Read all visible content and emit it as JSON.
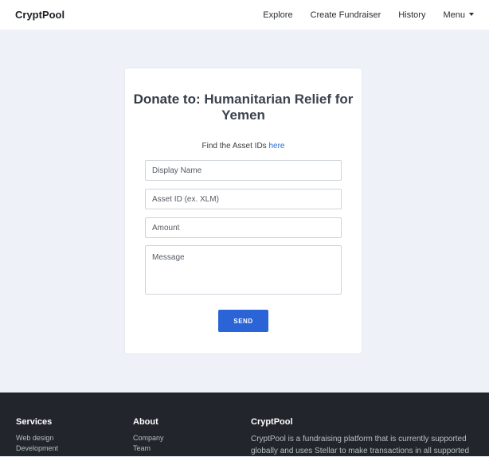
{
  "navbar": {
    "brand": "CryptPool",
    "links": [
      "Explore",
      "Create Fundraiser",
      "History",
      "Menu"
    ]
  },
  "form": {
    "title_bold": "Donate to:",
    "title_rest": "Humanitarian Relief for Yemen",
    "asset_note_text": "Find the Asset IDs",
    "asset_note_link": "here",
    "display_name_placeholder": "Display Name",
    "asset_id_placeholder": "Asset ID (ex. XLM)",
    "amount_placeholder": "Amount",
    "message_placeholder": "Message",
    "send_label": "SEND"
  },
  "footer": {
    "services": {
      "heading": "Services",
      "links": [
        "Web design",
        "Development"
      ]
    },
    "about": {
      "heading": "About",
      "links": [
        "Company",
        "Team"
      ]
    },
    "cryptpool": {
      "heading": "CryptPool",
      "text": "CryptPool is a fundraising platform that is currently supported globally and uses Stellar to make transactions in all supported"
    }
  },
  "colors": {
    "accent": "#2a64d6",
    "page_bg": "#eef2f8",
    "footer_bg": "#22262c"
  }
}
